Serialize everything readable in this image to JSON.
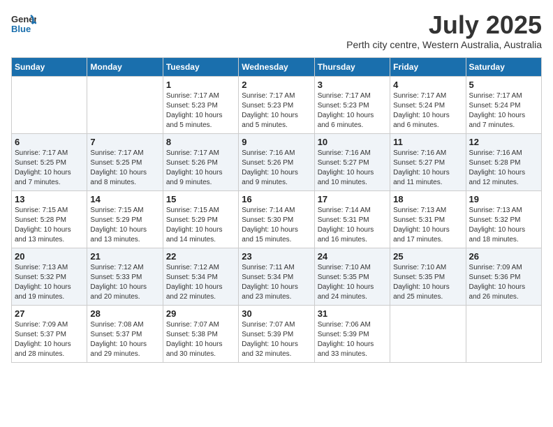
{
  "header": {
    "logo_general": "General",
    "logo_blue": "Blue",
    "title": "July 2025",
    "subtitle": "Perth city centre, Western Australia, Australia"
  },
  "weekdays": [
    "Sunday",
    "Monday",
    "Tuesday",
    "Wednesday",
    "Thursday",
    "Friday",
    "Saturday"
  ],
  "weeks": [
    [
      {
        "day": "",
        "info": ""
      },
      {
        "day": "",
        "info": ""
      },
      {
        "day": "1",
        "info": "Sunrise: 7:17 AM\nSunset: 5:23 PM\nDaylight: 10 hours\nand 5 minutes."
      },
      {
        "day": "2",
        "info": "Sunrise: 7:17 AM\nSunset: 5:23 PM\nDaylight: 10 hours\nand 5 minutes."
      },
      {
        "day": "3",
        "info": "Sunrise: 7:17 AM\nSunset: 5:23 PM\nDaylight: 10 hours\nand 6 minutes."
      },
      {
        "day": "4",
        "info": "Sunrise: 7:17 AM\nSunset: 5:24 PM\nDaylight: 10 hours\nand 6 minutes."
      },
      {
        "day": "5",
        "info": "Sunrise: 7:17 AM\nSunset: 5:24 PM\nDaylight: 10 hours\nand 7 minutes."
      }
    ],
    [
      {
        "day": "6",
        "info": "Sunrise: 7:17 AM\nSunset: 5:25 PM\nDaylight: 10 hours\nand 7 minutes."
      },
      {
        "day": "7",
        "info": "Sunrise: 7:17 AM\nSunset: 5:25 PM\nDaylight: 10 hours\nand 8 minutes."
      },
      {
        "day": "8",
        "info": "Sunrise: 7:17 AM\nSunset: 5:26 PM\nDaylight: 10 hours\nand 9 minutes."
      },
      {
        "day": "9",
        "info": "Sunrise: 7:16 AM\nSunset: 5:26 PM\nDaylight: 10 hours\nand 9 minutes."
      },
      {
        "day": "10",
        "info": "Sunrise: 7:16 AM\nSunset: 5:27 PM\nDaylight: 10 hours\nand 10 minutes."
      },
      {
        "day": "11",
        "info": "Sunrise: 7:16 AM\nSunset: 5:27 PM\nDaylight: 10 hours\nand 11 minutes."
      },
      {
        "day": "12",
        "info": "Sunrise: 7:16 AM\nSunset: 5:28 PM\nDaylight: 10 hours\nand 12 minutes."
      }
    ],
    [
      {
        "day": "13",
        "info": "Sunrise: 7:15 AM\nSunset: 5:28 PM\nDaylight: 10 hours\nand 13 minutes."
      },
      {
        "day": "14",
        "info": "Sunrise: 7:15 AM\nSunset: 5:29 PM\nDaylight: 10 hours\nand 13 minutes."
      },
      {
        "day": "15",
        "info": "Sunrise: 7:15 AM\nSunset: 5:29 PM\nDaylight: 10 hours\nand 14 minutes."
      },
      {
        "day": "16",
        "info": "Sunrise: 7:14 AM\nSunset: 5:30 PM\nDaylight: 10 hours\nand 15 minutes."
      },
      {
        "day": "17",
        "info": "Sunrise: 7:14 AM\nSunset: 5:31 PM\nDaylight: 10 hours\nand 16 minutes."
      },
      {
        "day": "18",
        "info": "Sunrise: 7:13 AM\nSunset: 5:31 PM\nDaylight: 10 hours\nand 17 minutes."
      },
      {
        "day": "19",
        "info": "Sunrise: 7:13 AM\nSunset: 5:32 PM\nDaylight: 10 hours\nand 18 minutes."
      }
    ],
    [
      {
        "day": "20",
        "info": "Sunrise: 7:13 AM\nSunset: 5:32 PM\nDaylight: 10 hours\nand 19 minutes."
      },
      {
        "day": "21",
        "info": "Sunrise: 7:12 AM\nSunset: 5:33 PM\nDaylight: 10 hours\nand 20 minutes."
      },
      {
        "day": "22",
        "info": "Sunrise: 7:12 AM\nSunset: 5:34 PM\nDaylight: 10 hours\nand 22 minutes."
      },
      {
        "day": "23",
        "info": "Sunrise: 7:11 AM\nSunset: 5:34 PM\nDaylight: 10 hours\nand 23 minutes."
      },
      {
        "day": "24",
        "info": "Sunrise: 7:10 AM\nSunset: 5:35 PM\nDaylight: 10 hours\nand 24 minutes."
      },
      {
        "day": "25",
        "info": "Sunrise: 7:10 AM\nSunset: 5:35 PM\nDaylight: 10 hours\nand 25 minutes."
      },
      {
        "day": "26",
        "info": "Sunrise: 7:09 AM\nSunset: 5:36 PM\nDaylight: 10 hours\nand 26 minutes."
      }
    ],
    [
      {
        "day": "27",
        "info": "Sunrise: 7:09 AM\nSunset: 5:37 PM\nDaylight: 10 hours\nand 28 minutes."
      },
      {
        "day": "28",
        "info": "Sunrise: 7:08 AM\nSunset: 5:37 PM\nDaylight: 10 hours\nand 29 minutes."
      },
      {
        "day": "29",
        "info": "Sunrise: 7:07 AM\nSunset: 5:38 PM\nDaylight: 10 hours\nand 30 minutes."
      },
      {
        "day": "30",
        "info": "Sunrise: 7:07 AM\nSunset: 5:39 PM\nDaylight: 10 hours\nand 32 minutes."
      },
      {
        "day": "31",
        "info": "Sunrise: 7:06 AM\nSunset: 5:39 PM\nDaylight: 10 hours\nand 33 minutes."
      },
      {
        "day": "",
        "info": ""
      },
      {
        "day": "",
        "info": ""
      }
    ]
  ]
}
